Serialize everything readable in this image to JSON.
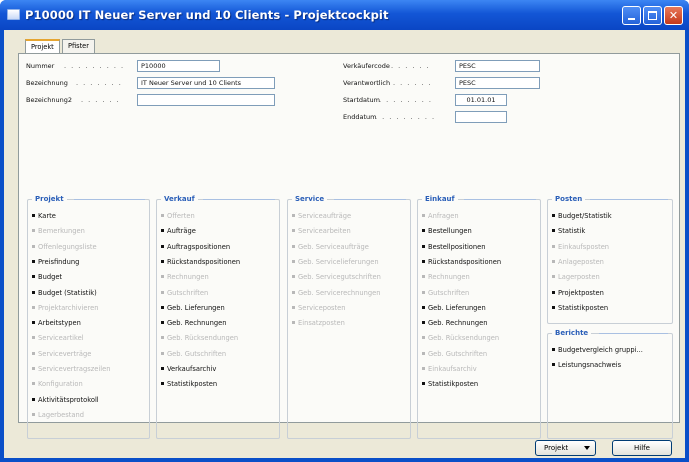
{
  "window": {
    "title": "P10000 IT Neuer Server und 10 Clients - Projektcockpit"
  },
  "tabs": [
    "Projekt",
    "Pfister"
  ],
  "fields": {
    "nummer": {
      "label": "Nummer",
      "value": "P10000"
    },
    "bezeichnung": {
      "label": "Bezeichnung",
      "value": "IT Neuer Server und 10 Clients"
    },
    "bezeichnung2": {
      "label": "Bezeichnung2",
      "value": ""
    },
    "verkaeufercode": {
      "label": "Verkäufercode",
      "value": "PESC"
    },
    "verantwortlich": {
      "label": "Verantwortlich",
      "value": "PESC"
    },
    "startdatum": {
      "label": "Startdatum",
      "value": "01.01.01"
    },
    "enddatum": {
      "label": "Enddatum",
      "value": ""
    }
  },
  "groups": [
    {
      "title": "Projekt",
      "items": [
        {
          "label": "Karte",
          "enabled": true
        },
        {
          "label": "Bemerkungen",
          "enabled": false
        },
        {
          "label": "Offenlegungsliste",
          "enabled": false
        },
        {
          "label": "Preisfindung",
          "enabled": true
        },
        {
          "label": "Budget",
          "enabled": true
        },
        {
          "label": "Budget (Statistik)",
          "enabled": true
        },
        {
          "label": "Projektarchivieren",
          "enabled": false
        },
        {
          "label": "Arbeitstypen",
          "enabled": true
        },
        {
          "label": "Serviceartikel",
          "enabled": false
        },
        {
          "label": "Serviceverträge",
          "enabled": false
        },
        {
          "label": "Servicevertragszeilen",
          "enabled": false
        },
        {
          "label": "Konfiguration",
          "enabled": false
        },
        {
          "label": "Aktivitätsprotokoll",
          "enabled": true
        },
        {
          "label": "Lagerbestand",
          "enabled": false
        }
      ]
    },
    {
      "title": "Verkauf",
      "items": [
        {
          "label": "Offerten",
          "enabled": false
        },
        {
          "label": "Aufträge",
          "enabled": true
        },
        {
          "label": "Auftragspositionen",
          "enabled": true
        },
        {
          "label": "Rückstandspositionen",
          "enabled": true
        },
        {
          "label": "Rechnungen",
          "enabled": false
        },
        {
          "label": "Gutschriften",
          "enabled": false
        },
        {
          "label": "Geb. Lieferungen",
          "enabled": true
        },
        {
          "label": "Geb. Rechnungen",
          "enabled": true
        },
        {
          "label": "Geb. Rücksendungen",
          "enabled": false
        },
        {
          "label": "Geb. Gutschriften",
          "enabled": false
        },
        {
          "label": "Verkaufsarchiv",
          "enabled": true
        },
        {
          "label": "Statistikposten",
          "enabled": true
        }
      ]
    },
    {
      "title": "Service",
      "items": [
        {
          "label": "Serviceaufträge",
          "enabled": false
        },
        {
          "label": "Servicearbeiten",
          "enabled": false
        },
        {
          "label": "Geb. Serviceaufträge",
          "enabled": false
        },
        {
          "label": "Geb. Servicelieferungen",
          "enabled": false
        },
        {
          "label": "Geb. Servicegutschriften",
          "enabled": false
        },
        {
          "label": "Geb. Servicerechnungen",
          "enabled": false
        },
        {
          "label": "Serviceposten",
          "enabled": false
        },
        {
          "label": "Einsatzposten",
          "enabled": false
        }
      ]
    },
    {
      "title": "Einkauf",
      "items": [
        {
          "label": "Anfragen",
          "enabled": false
        },
        {
          "label": "Bestellungen",
          "enabled": true
        },
        {
          "label": "Bestellpositionen",
          "enabled": true
        },
        {
          "label": "Rückstandspositionen",
          "enabled": true
        },
        {
          "label": "Rechnungen",
          "enabled": false
        },
        {
          "label": "Gutschriften",
          "enabled": false
        },
        {
          "label": "Geb. Lieferungen",
          "enabled": true
        },
        {
          "label": "Geb. Rechnungen",
          "enabled": true
        },
        {
          "label": "Geb. Rücksendungen",
          "enabled": false
        },
        {
          "label": "Geb. Gutschriften",
          "enabled": false
        },
        {
          "label": "Einkaufsarchiv",
          "enabled": false
        },
        {
          "label": "Statistikposten",
          "enabled": true
        }
      ]
    },
    {
      "title": "Posten",
      "items": [
        {
          "label": "Budget/Statistik",
          "enabled": true
        },
        {
          "label": "Statistik",
          "enabled": true
        },
        {
          "label": "Einkaufsposten",
          "enabled": false
        },
        {
          "label": "Anlageposten",
          "enabled": false
        },
        {
          "label": "Lagerposten",
          "enabled": false
        },
        {
          "label": "Projektposten",
          "enabled": true
        },
        {
          "label": "Statistikposten",
          "enabled": true
        }
      ]
    }
  ],
  "berichte": {
    "title": "Berichte",
    "items": [
      {
        "label": "Budgetvergleich gruppi...",
        "enabled": true
      },
      {
        "label": "Leistungsnachweis",
        "enabled": true
      }
    ]
  },
  "buttons": {
    "projekt": "Projekt",
    "hilfe": "Hilfe"
  }
}
